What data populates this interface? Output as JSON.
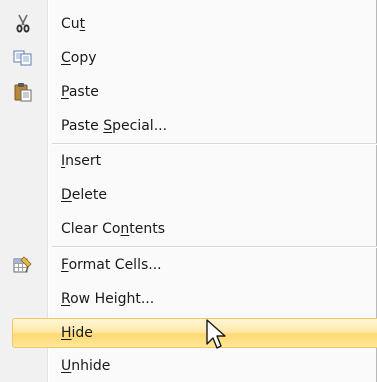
{
  "menu": {
    "items": [
      {
        "id": "cut",
        "pre": "Cu",
        "key": "t",
        "post": "",
        "icon": "scissors-icon"
      },
      {
        "id": "copy",
        "pre": "",
        "key": "C",
        "post": "opy",
        "icon": "copy-icon"
      },
      {
        "id": "paste",
        "pre": "",
        "key": "P",
        "post": "aste",
        "icon": "paste-icon"
      },
      {
        "id": "paste-special",
        "pre": "Paste ",
        "key": "S",
        "post": "pecial...",
        "icon": ""
      },
      {
        "id": "insert",
        "pre": "",
        "key": "I",
        "post": "nsert",
        "icon": ""
      },
      {
        "id": "delete",
        "pre": "",
        "key": "D",
        "post": "elete",
        "icon": ""
      },
      {
        "id": "clear-contents",
        "pre": "Clear Co",
        "key": "n",
        "post": "tents",
        "icon": ""
      },
      {
        "id": "format-cells",
        "pre": "",
        "key": "F",
        "post": "ormat Cells...",
        "icon": "format-cells-icon"
      },
      {
        "id": "row-height",
        "pre": "",
        "key": "R",
        "post": "ow Height...",
        "icon": ""
      },
      {
        "id": "hide",
        "pre": "",
        "key": "H",
        "post": "ide",
        "icon": "",
        "highlighted": true
      },
      {
        "id": "unhide",
        "pre": "",
        "key": "U",
        "post": "nhide",
        "icon": ""
      }
    ]
  },
  "colors": {
    "highlight_border": "#f2c867",
    "highlight_fill": "#ffe08a",
    "gutter": "#f1f1f1",
    "text": "#1a1a1a"
  }
}
